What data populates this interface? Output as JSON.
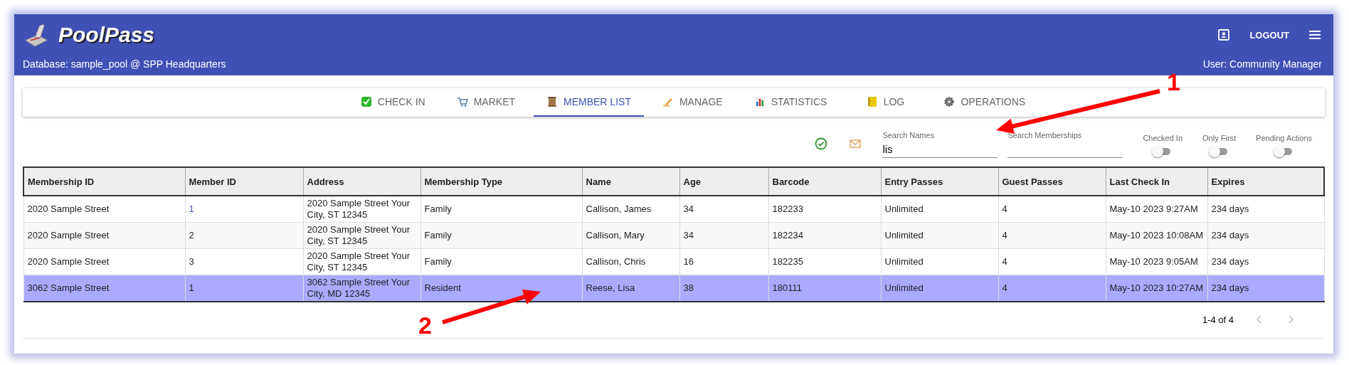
{
  "app": {
    "title": "PoolPass",
    "database": "Database: sample_pool @ SPP Headquarters",
    "user": "User: Community Manager",
    "logout": "LOGOUT"
  },
  "tabs": [
    {
      "label": "CHECK IN",
      "kind": "check",
      "selected": false
    },
    {
      "label": "MARKET",
      "kind": "cart",
      "selected": false
    },
    {
      "label": "MEMBER LIST",
      "kind": "scroll",
      "selected": true
    },
    {
      "label": "MANAGE",
      "kind": "pen",
      "selected": false
    },
    {
      "label": "STATISTICS",
      "kind": "chart",
      "selected": false
    },
    {
      "label": "LOG",
      "kind": "notebook",
      "selected": false
    },
    {
      "label": "OPERATIONS",
      "kind": "gear",
      "selected": false
    }
  ],
  "filters": {
    "search_names": {
      "label": "Search Names",
      "value": "lis"
    },
    "search_memberships": {
      "label": "Search Memberships"
    },
    "toggles": [
      {
        "label": "Checked In",
        "on": false
      },
      {
        "label": "Only First",
        "on": false
      },
      {
        "label": "Pending Actions",
        "on": false
      }
    ]
  },
  "table": {
    "columns": [
      "Membership ID",
      "Member ID",
      "Address",
      "Membership Type",
      "Name",
      "Age",
      "Barcode",
      "Entry Passes",
      "Guest Passes",
      "Last Check In",
      "Expires"
    ],
    "rows": [
      {
        "selected": false,
        "member_id_link": true,
        "cells": [
          "2020 Sample Street",
          "1",
          "2020 Sample Street Your City, ST 12345",
          "Family",
          "Callison, James",
          "34",
          "182233",
          "Unlimited",
          "4",
          "May-10 2023 9:27AM",
          "234 days"
        ]
      },
      {
        "selected": false,
        "member_id_link": false,
        "cells": [
          "2020 Sample Street",
          "2",
          "2020 Sample Street Your City, ST 12345",
          "Family",
          "Callison, Mary",
          "34",
          "182234",
          "Unlimited",
          "4",
          "May-10 2023 10:08AM",
          "234 days"
        ]
      },
      {
        "selected": false,
        "member_id_link": false,
        "cells": [
          "2020 Sample Street",
          "3",
          "2020 Sample Street Your City, ST 12345",
          "Family",
          "Callison, Chris",
          "16",
          "182235",
          "Unlimited",
          "4",
          "May-10 2023 9:05AM",
          "234 days"
        ]
      },
      {
        "selected": true,
        "member_id_link": false,
        "cells": [
          "3062 Sample Street",
          "1",
          "3062 Sample Street Your City, MD 12345",
          "Resident",
          "Reese, Lisa",
          "38",
          "180111",
          "Unlimited",
          "4",
          "May-10 2023 10:27AM",
          "234 days"
        ]
      }
    ],
    "pagination": "1-4 of 4"
  },
  "annotations": [
    {
      "label": "1"
    },
    {
      "label": "2"
    }
  ]
}
